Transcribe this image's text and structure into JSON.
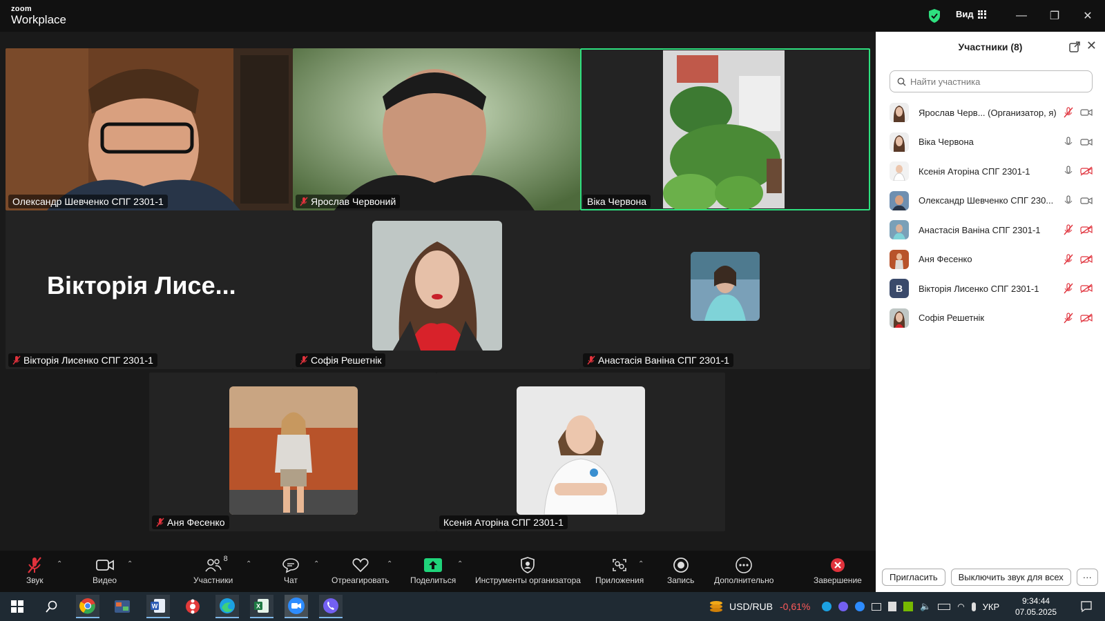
{
  "window": {
    "logo_top": "zoom",
    "logo_bottom": "Workplace",
    "view_label": "Вид",
    "colors": {
      "accent_green": "#2ee07f",
      "mute_red": "#e0323c",
      "share_green": "#1fd47a"
    }
  },
  "tiles": [
    {
      "name": "Олександр Шевченко СПГ 2301-1",
      "muted": false
    },
    {
      "name": "Ярослав Червоний",
      "muted": true
    },
    {
      "name": "Віка Червона",
      "muted": false,
      "active": true
    },
    {
      "name": "Вікторія Лисенко СПГ 2301-1",
      "muted": true,
      "big_text": "Вікторія Лисе..."
    },
    {
      "name": "Софія Решетнік",
      "muted": true
    },
    {
      "name": "Анастасія Ваніна СПГ 2301-1",
      "muted": true
    },
    {
      "name": "Аня Фесенко",
      "muted": true
    },
    {
      "name": "Ксенія Аторіна СПГ 2301-1",
      "muted": false
    }
  ],
  "panel": {
    "title": "Участники (8)",
    "search_placeholder": "Найти участника",
    "participants": [
      {
        "name": "Ярослав Черв... (Организатор, я)",
        "mic": "muted",
        "video": "on"
      },
      {
        "name": "Віка Червона",
        "mic": "on",
        "video": "on"
      },
      {
        "name": "Ксенія Аторіна СПГ 2301-1",
        "mic": "on",
        "video": "off"
      },
      {
        "name": "Олександр Шевченко СПГ 230...",
        "mic": "on",
        "video": "on"
      },
      {
        "name": "Анастасія Ваніна СПГ 2301-1",
        "mic": "muted",
        "video": "off"
      },
      {
        "name": "Аня Фесенко",
        "mic": "muted",
        "video": "off"
      },
      {
        "name": "Вікторія Лисенко СПГ 2301-1",
        "mic": "muted",
        "video": "off",
        "avatar_letter": "В"
      },
      {
        "name": "Софія Решетнік",
        "mic": "muted",
        "video": "off"
      }
    ],
    "invite_label": "Пригласить",
    "mute_all_label": "Выключить звук для всех",
    "more_label": "···"
  },
  "toolbar": {
    "audio": "Звук",
    "video": "Видео",
    "participants": "Участники",
    "participants_count": "8",
    "chat": "Чат",
    "react": "Отреагировать",
    "share": "Поделиться",
    "host_tools": "Инструменты организатора",
    "apps": "Приложения",
    "record": "Запись",
    "more": "Дополнительно",
    "end": "Завершение"
  },
  "taskbar": {
    "ticker": "USD/RUB",
    "ticker_change": "-0,61%",
    "lang": "УКР",
    "time": "9:34:44",
    "date": "07.05.2025"
  }
}
